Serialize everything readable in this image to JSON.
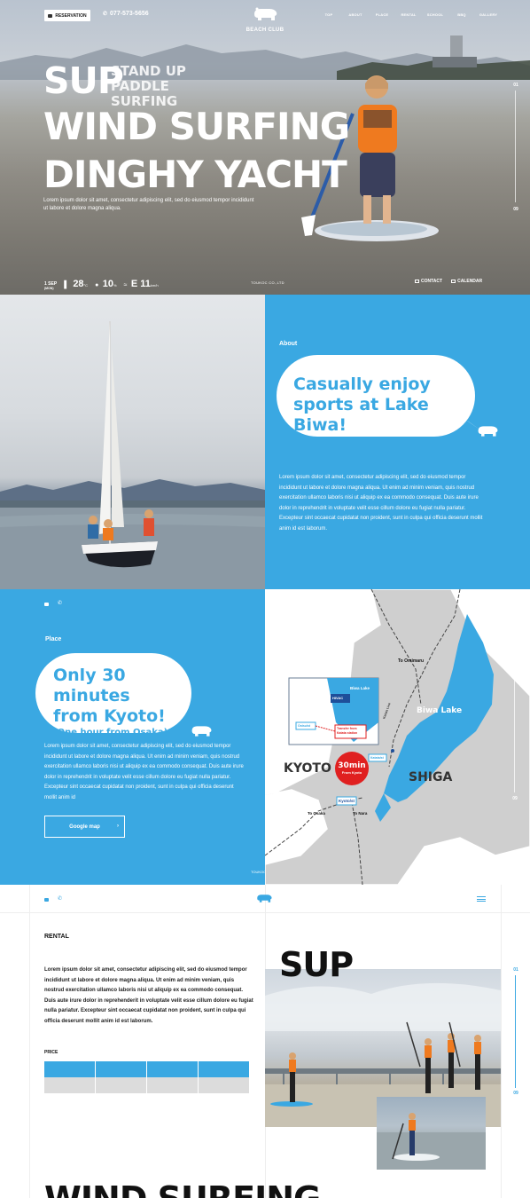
{
  "colors": {
    "accent": "#3aa8e2",
    "text": "#222222",
    "map_bg": "#e1e1e1",
    "lake": "#3aa8e2",
    "badge_red": "#e02020"
  },
  "hero": {
    "reservation_label": "RESERVATION",
    "phone": "077-573-5656",
    "logo_text": "BEACH CLUB",
    "nav": [
      "TOP",
      "ABOUT",
      "PLACE",
      "RENTAL",
      "SCHOOL",
      "BBQ",
      "GALLERY"
    ],
    "headline": {
      "sup": "SUP",
      "sup_sub_1": "STAND UP",
      "sup_sub_2": "PADDLE SURFING",
      "line2": "WIND SURFING",
      "line3": "DINGHY YACHT"
    },
    "lorem": "Lorem ipsum dolor sit amet, consectetur adipiscing elit, sed do eiusmod tempor incididunt ut labore et dolore magna aliqua.",
    "weather": {
      "date_top": "1 SEP",
      "date_bottom": "(MON)",
      "temp": "28",
      "temp_unit": "°C",
      "humidity": "10",
      "humidity_unit": "%",
      "wind": "E 11",
      "wind_unit": "km/h"
    },
    "company": "TOUKOC CO.,LTD",
    "links": {
      "contact": "CONTACT",
      "calendar": "CALENDAR"
    },
    "pager": {
      "current": "01",
      "total": "09"
    }
  },
  "about": {
    "label": "About",
    "bubble_line1": "Casually enjoy",
    "bubble_line2": "sports at Lake Biwa!",
    "lorem": "Lorem ipsum dolor sit amet, consectetur adipiscing elit, sed do eiusmod tempor incididunt ut labore et dolore magna aliqua. Ut enim ad minim veniam, quis nostrud exercitation ullamco laboris nisi ut aliquip ex ea commodo consequat. Duis aute irure dolor in reprehendrit in voluptate velit esse cillum dolore eu fugiat nulla pariatur. Excepteur sint occaecat cupidatat non proident, sunt in culpa qui officia deserunt mollit anim id est laborum."
  },
  "place": {
    "label": "Place",
    "bubble_line1": "Only 30 minutes",
    "bubble_line2": "from Kyoto!",
    "bubble_line3": "(One hour from Osaka)",
    "lorem": "Lorem ipsum dolor sit amet, consectetur adipiscing elit, sed do eiusmod tempor incididunt ut labore et dolore magna aliqua. Ut enim ad minim veniam, quis nostrud exercitation ullamco laboris nisi ut aliquip ex ea commodo consequat. Duis aute irure dolor in reprehendrit in voluptate velit esse cillum dolore eu fugiat nulla pariatur. Excepteur sint occaecat cupidatat non proident, sunt in culpa qui officia deserunt mollit anim id",
    "button": "Google map",
    "company": "TOUKOC",
    "pager": {
      "current": "01",
      "total": "09"
    },
    "map": {
      "to_omimaru": "To Omimaru",
      "biwa_lake": "Biwa Lake",
      "kyoto": "KYOTO",
      "shiga": "SHIGA",
      "badge_big": "30min",
      "badge_small": "From Kyoto",
      "to_osaka": "To Osaka",
      "to_nara": "To Nara",
      "kyoto_st": "Kyoto/st",
      "inset_lake": "Biwa Lake",
      "inset_hivac": "HIVAC",
      "inset_transfer_1": "Transfer from",
      "inset_transfer_2": "Katata station",
      "inset_station": "Katata/st",
      "inset_left_station": "Ostsu/st",
      "route_label": "Katata Line",
      "small_station": "Katata/st"
    }
  },
  "rental": {
    "title": "RENTAL",
    "lorem": "Lorem ipsum dolor sit amet, consectetur adipiscing elit, sed do eiusmod tempor incididunt ut labore et dolore magna aliqua. Ut enim ad minim veniam, quis nostrud exercitation ullamco laboris nisi ut aliquip ex ea commodo consequat. Duis aute irure dolor in reprehenderit in voluptate velit esse cillum dolore eu fugiat nulla pariatur. Excepteur sint occaecat cupidatat non proident, sunt in culpa qui officia deserunt mollit anim id est laborum.",
    "price_label": "PRICE",
    "sup_heading": "SUP",
    "next_heading": "WIND SURFING",
    "pager": {
      "current": "01",
      "total": "09"
    }
  }
}
